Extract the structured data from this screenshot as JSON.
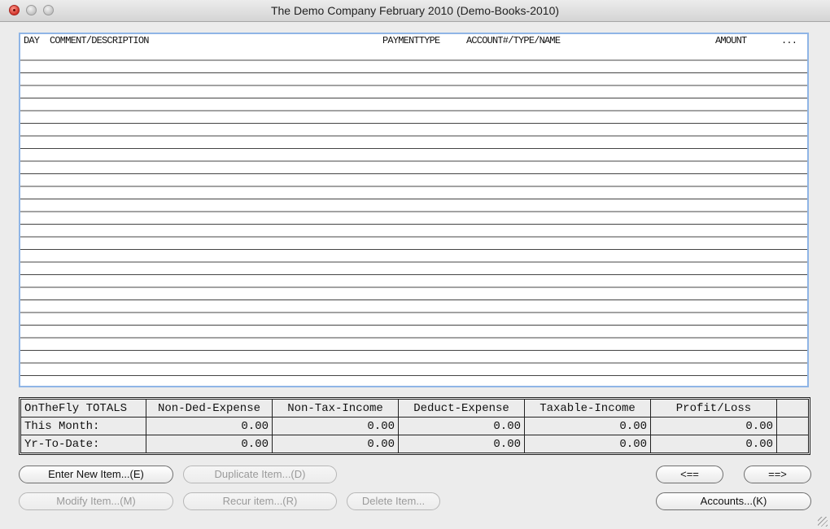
{
  "window": {
    "title": "The Demo Company  February 2010  (Demo-Books-2010)"
  },
  "list": {
    "headers": {
      "day": "DAY",
      "description": "COMMENT/DESCRIPTION",
      "payment_type": "PAYMENTTYPE",
      "account": "ACCOUNT#/TYPE/NAME",
      "amount": "AMOUNT",
      "more": "..."
    },
    "rows": []
  },
  "totals": {
    "corner_label": "OnTheFly TOTALS",
    "columns": [
      "Non-Ded-Expense",
      "Non-Tax-Income",
      "Deduct-Expense",
      "Taxable-Income",
      "Profit/Loss"
    ],
    "rows": [
      {
        "label": "This Month:",
        "values": [
          "0.00",
          "0.00",
          "0.00",
          "0.00",
          "0.00"
        ]
      },
      {
        "label": "Yr-To-Date:",
        "values": [
          "0.00",
          "0.00",
          "0.00",
          "0.00",
          "0.00"
        ]
      }
    ]
  },
  "buttons": {
    "enter_new": "Enter New Item...(E)",
    "duplicate": "Duplicate Item...(D)",
    "modify": "Modify Item...(M)",
    "recur": "Recur item...(R)",
    "delete": "Delete Item...",
    "prev": "<==",
    "next": "==>",
    "accounts": "Accounts...(K)"
  }
}
